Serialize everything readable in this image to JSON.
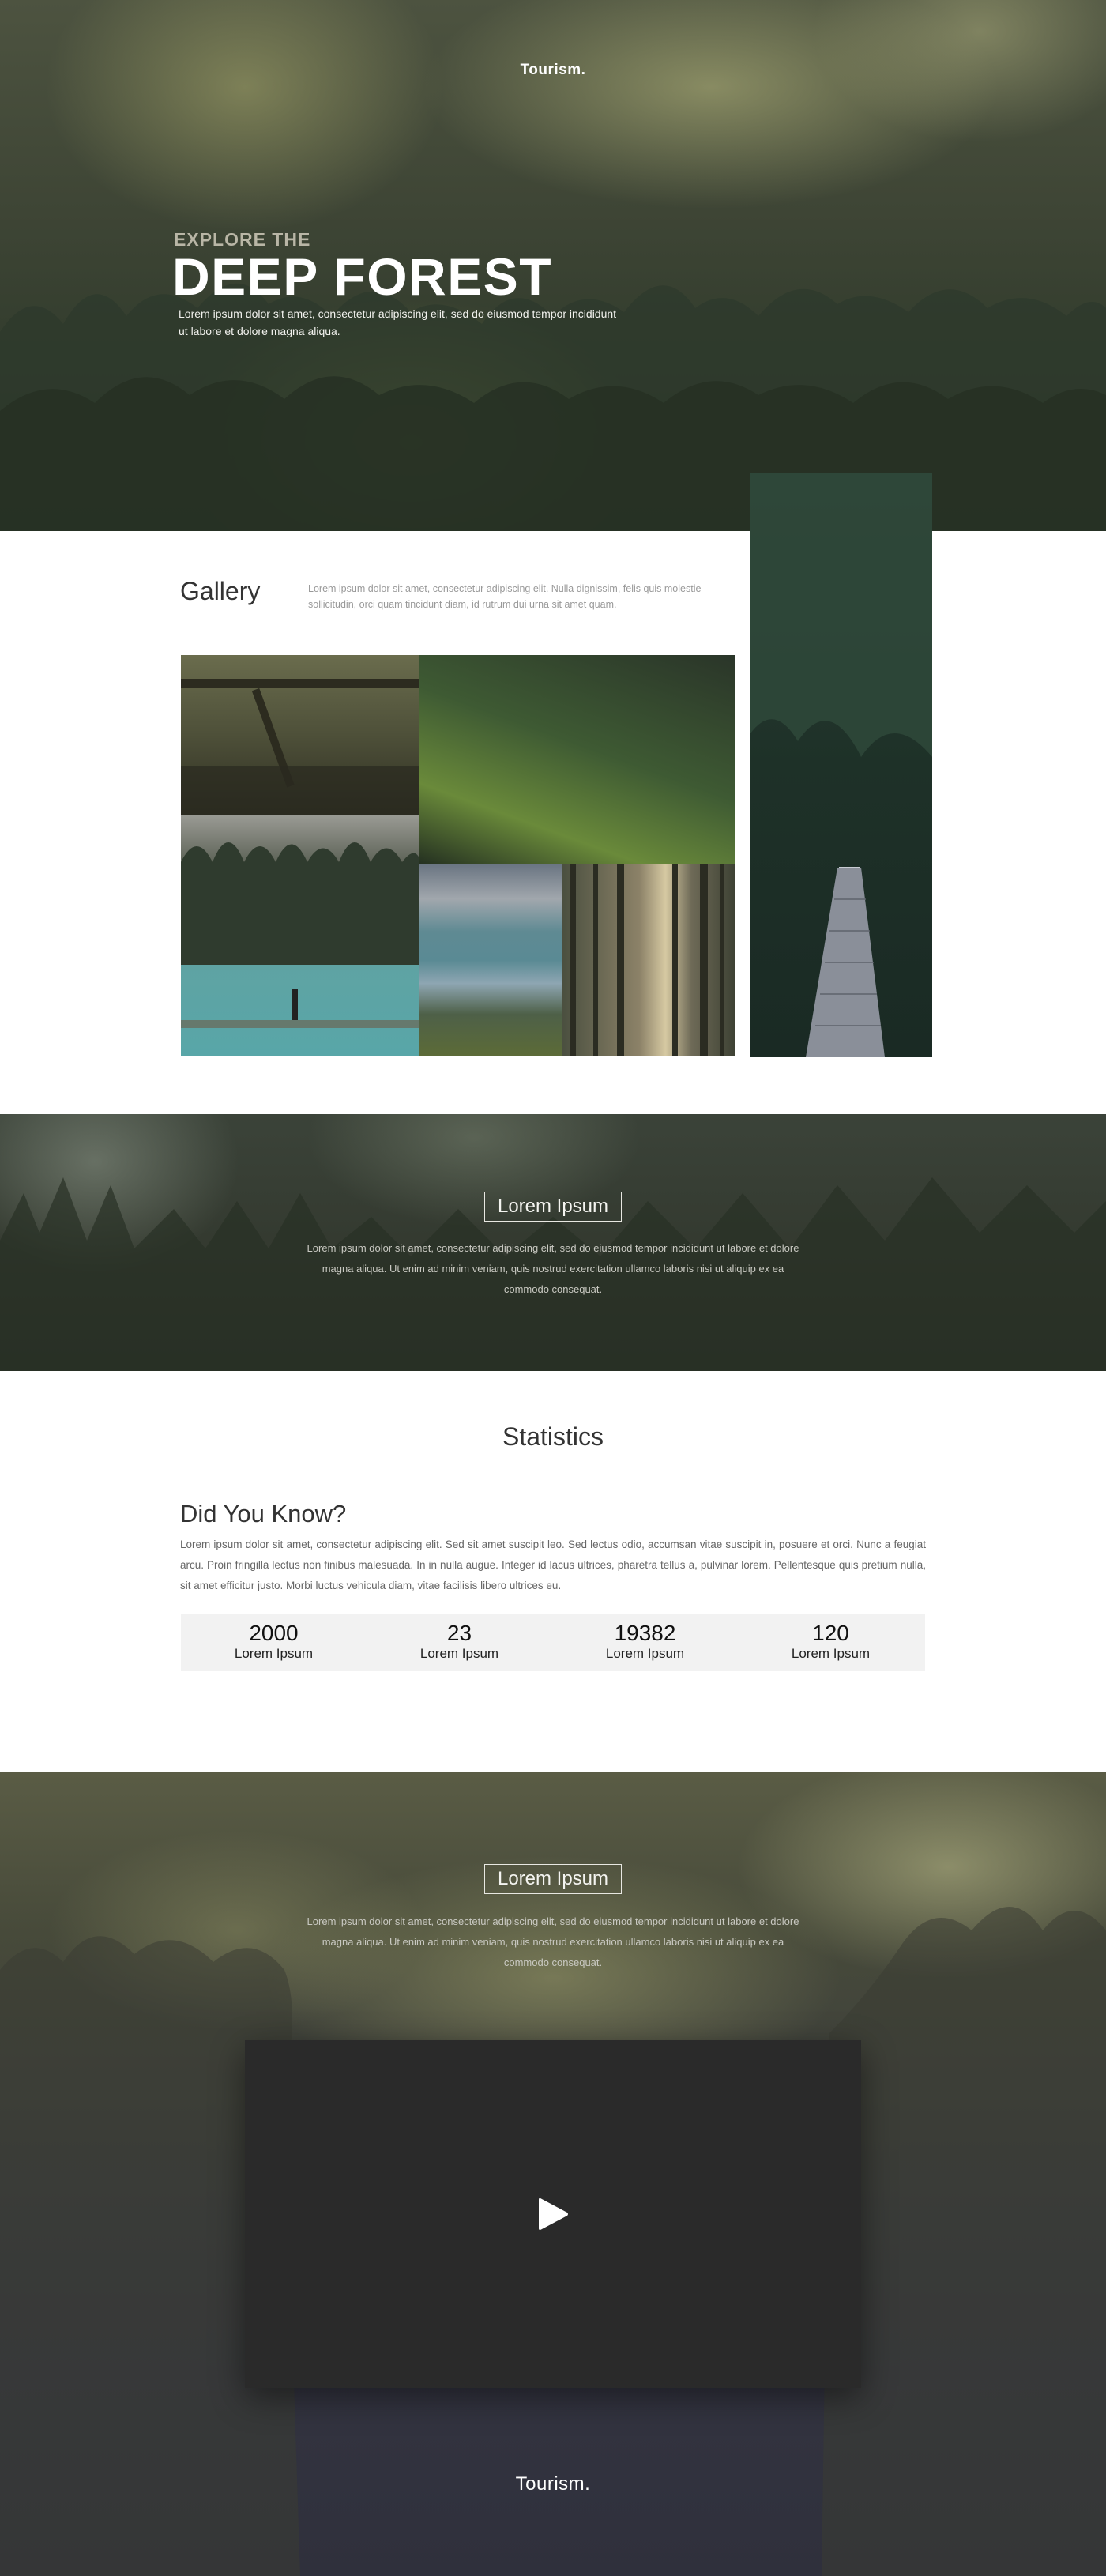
{
  "hero": {
    "logo": "Tourism.",
    "kicker": "EXPLORE THE",
    "title": "DEEP FOREST",
    "text": "Lorem ipsum dolor sit amet, consectetur adipiscing elit, sed do eiusmod tempor incididunt ut labore et dolore magna aliqua."
  },
  "gallery": {
    "title": "Gallery",
    "text": "Lorem ipsum dolor sit amet, consectetur adipiscing elit. Nulla dignissim, felis quis molestie sollicitudin, orci quam tincidunt diam, id rutrum dui urna sit amet quam."
  },
  "banner": {
    "button": "Lorem Ipsum",
    "text": "Lorem ipsum dolor sit amet, consectetur adipiscing elit, sed do eiusmod tempor incididunt ut labore et dolore magna aliqua. Ut enim ad minim veniam, quis nostrud exercitation ullamco laboris nisi ut aliquip ex ea commodo consequat."
  },
  "statistics": {
    "title": "Statistics",
    "subtitle": "Did You Know?",
    "text": "Lorem ipsum dolor sit amet, consectetur adipiscing elit. Sed sit amet suscipit leo. Sed lectus odio, accumsan vitae suscipit in, posuere et orci. Nunc a feugiat arcu. Proin fringilla lectus non finibus malesuada. In in nulla augue. Integer id lacus ultrices, pharetra tellus a, pulvinar lorem. Pellentesque quis pretium nulla, sit amet efficitur justo. Morbi luctus vehicula diam, vitae facilisis libero ultrices eu.",
    "items": [
      {
        "value": "2000",
        "label": "Lorem Ipsum"
      },
      {
        "value": "23",
        "label": "Lorem Ipsum"
      },
      {
        "value": "19382",
        "label": "Lorem Ipsum"
      },
      {
        "value": "120",
        "label": "Lorem Ipsum"
      }
    ]
  },
  "video": {
    "button": "Lorem Ipsum",
    "text": "Lorem ipsum dolor sit amet, consectetur adipiscing elit, sed do eiusmod tempor incididunt ut labore et dolore magna aliqua. Ut enim ad minim veniam, quis nostrud exercitation ullamco laboris nisi ut aliquip ex ea commodo consequat.",
    "play_icon": "play-icon"
  },
  "footer": {
    "logo": "Tourism."
  }
}
